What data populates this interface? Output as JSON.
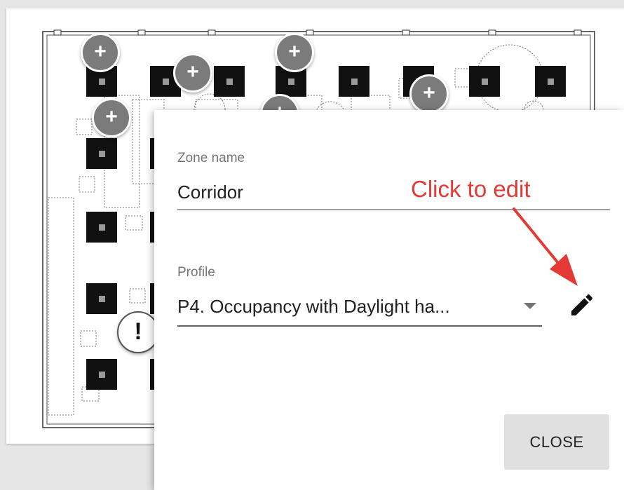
{
  "floorplan": {
    "add_button_symbol": "+",
    "warning_symbol": "!"
  },
  "dialog": {
    "zone_name_label": "Zone name",
    "zone_name_value": "Corridor",
    "profile_label": "Profile",
    "profile_value": "P4. Occupancy with Daylight ha...",
    "edit_icon": "pencil-icon",
    "dropdown_icon": "dropdown-arrow-icon",
    "close_label": "CLOSE"
  },
  "annotation": {
    "text": "Click to edit",
    "color": "#e53935"
  }
}
